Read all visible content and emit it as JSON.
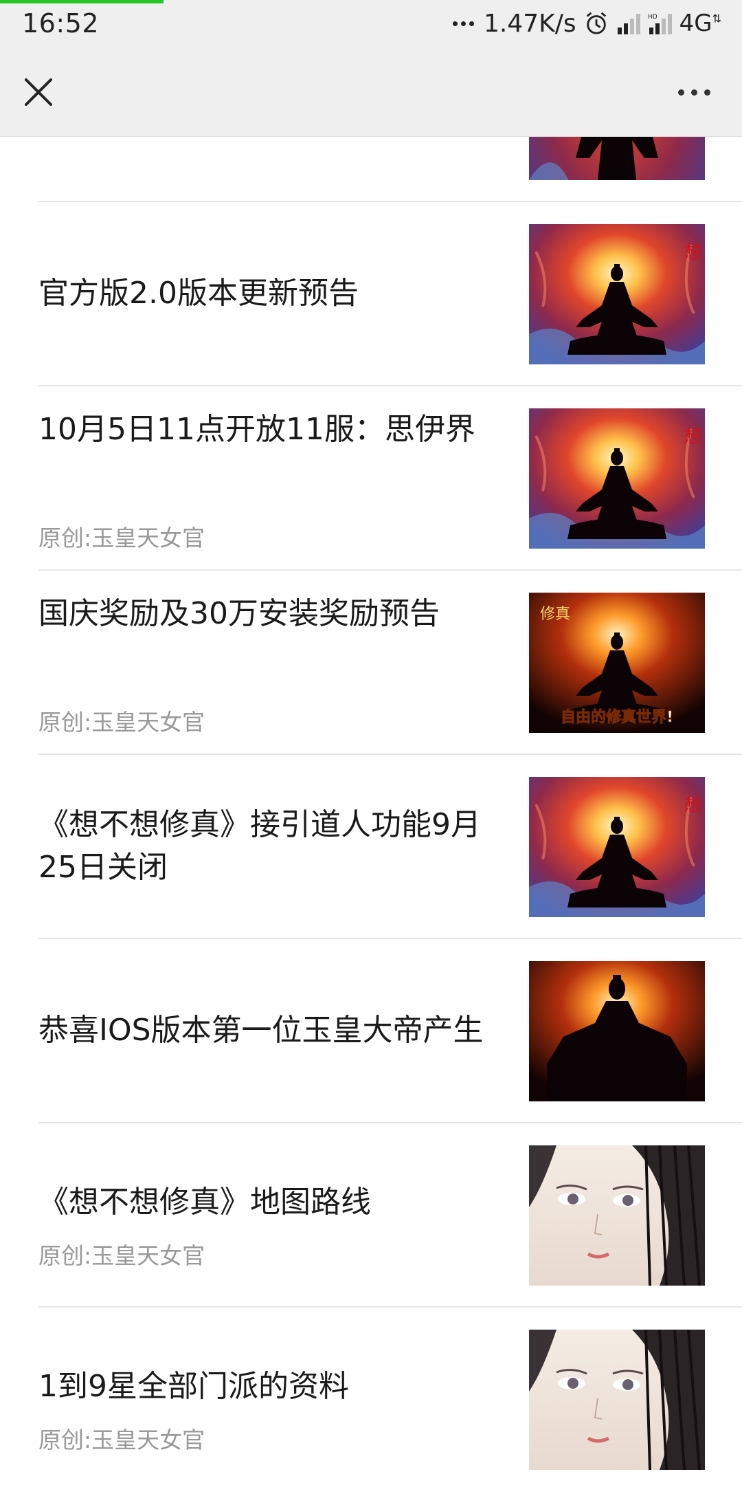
{
  "status_bar": {
    "time": "16:52",
    "net_speed": "1.47K/s",
    "network": "4G"
  },
  "page_load_progress": 0.22,
  "nav": {
    "close_icon": "close-icon",
    "more_icon": "more-dots-icon"
  },
  "articles": [
    {
      "title": "官方版2.0版本更新预告",
      "source": "",
      "thumb": "meditating-figure-fire"
    },
    {
      "title": "10月5日11点开放11服：思伊界",
      "source": "原创:玉皇天女官",
      "thumb": "meditating-figure-fire"
    },
    {
      "title": "国庆奖励及30万安装奖励预告",
      "source": "原创:玉皇天女官",
      "thumb": "meditating-figure-banner",
      "thumb_caption": "自由的修真世界!"
    },
    {
      "title": "《想不想修真》接引道人功能9月25日关闭",
      "source": "",
      "thumb": "meditating-figure-fire"
    },
    {
      "title": "恭喜IOS版本第一位玉皇大帝产生",
      "source": "",
      "thumb": "emperor-silhouette"
    },
    {
      "title": "《想不想修真》地图路线",
      "source": "原创:玉皇天女官",
      "thumb": "anime-portrait"
    },
    {
      "title": "1到9星全部门派的资料",
      "source": "原创:玉皇天女官",
      "thumb": "anime-portrait"
    }
  ]
}
